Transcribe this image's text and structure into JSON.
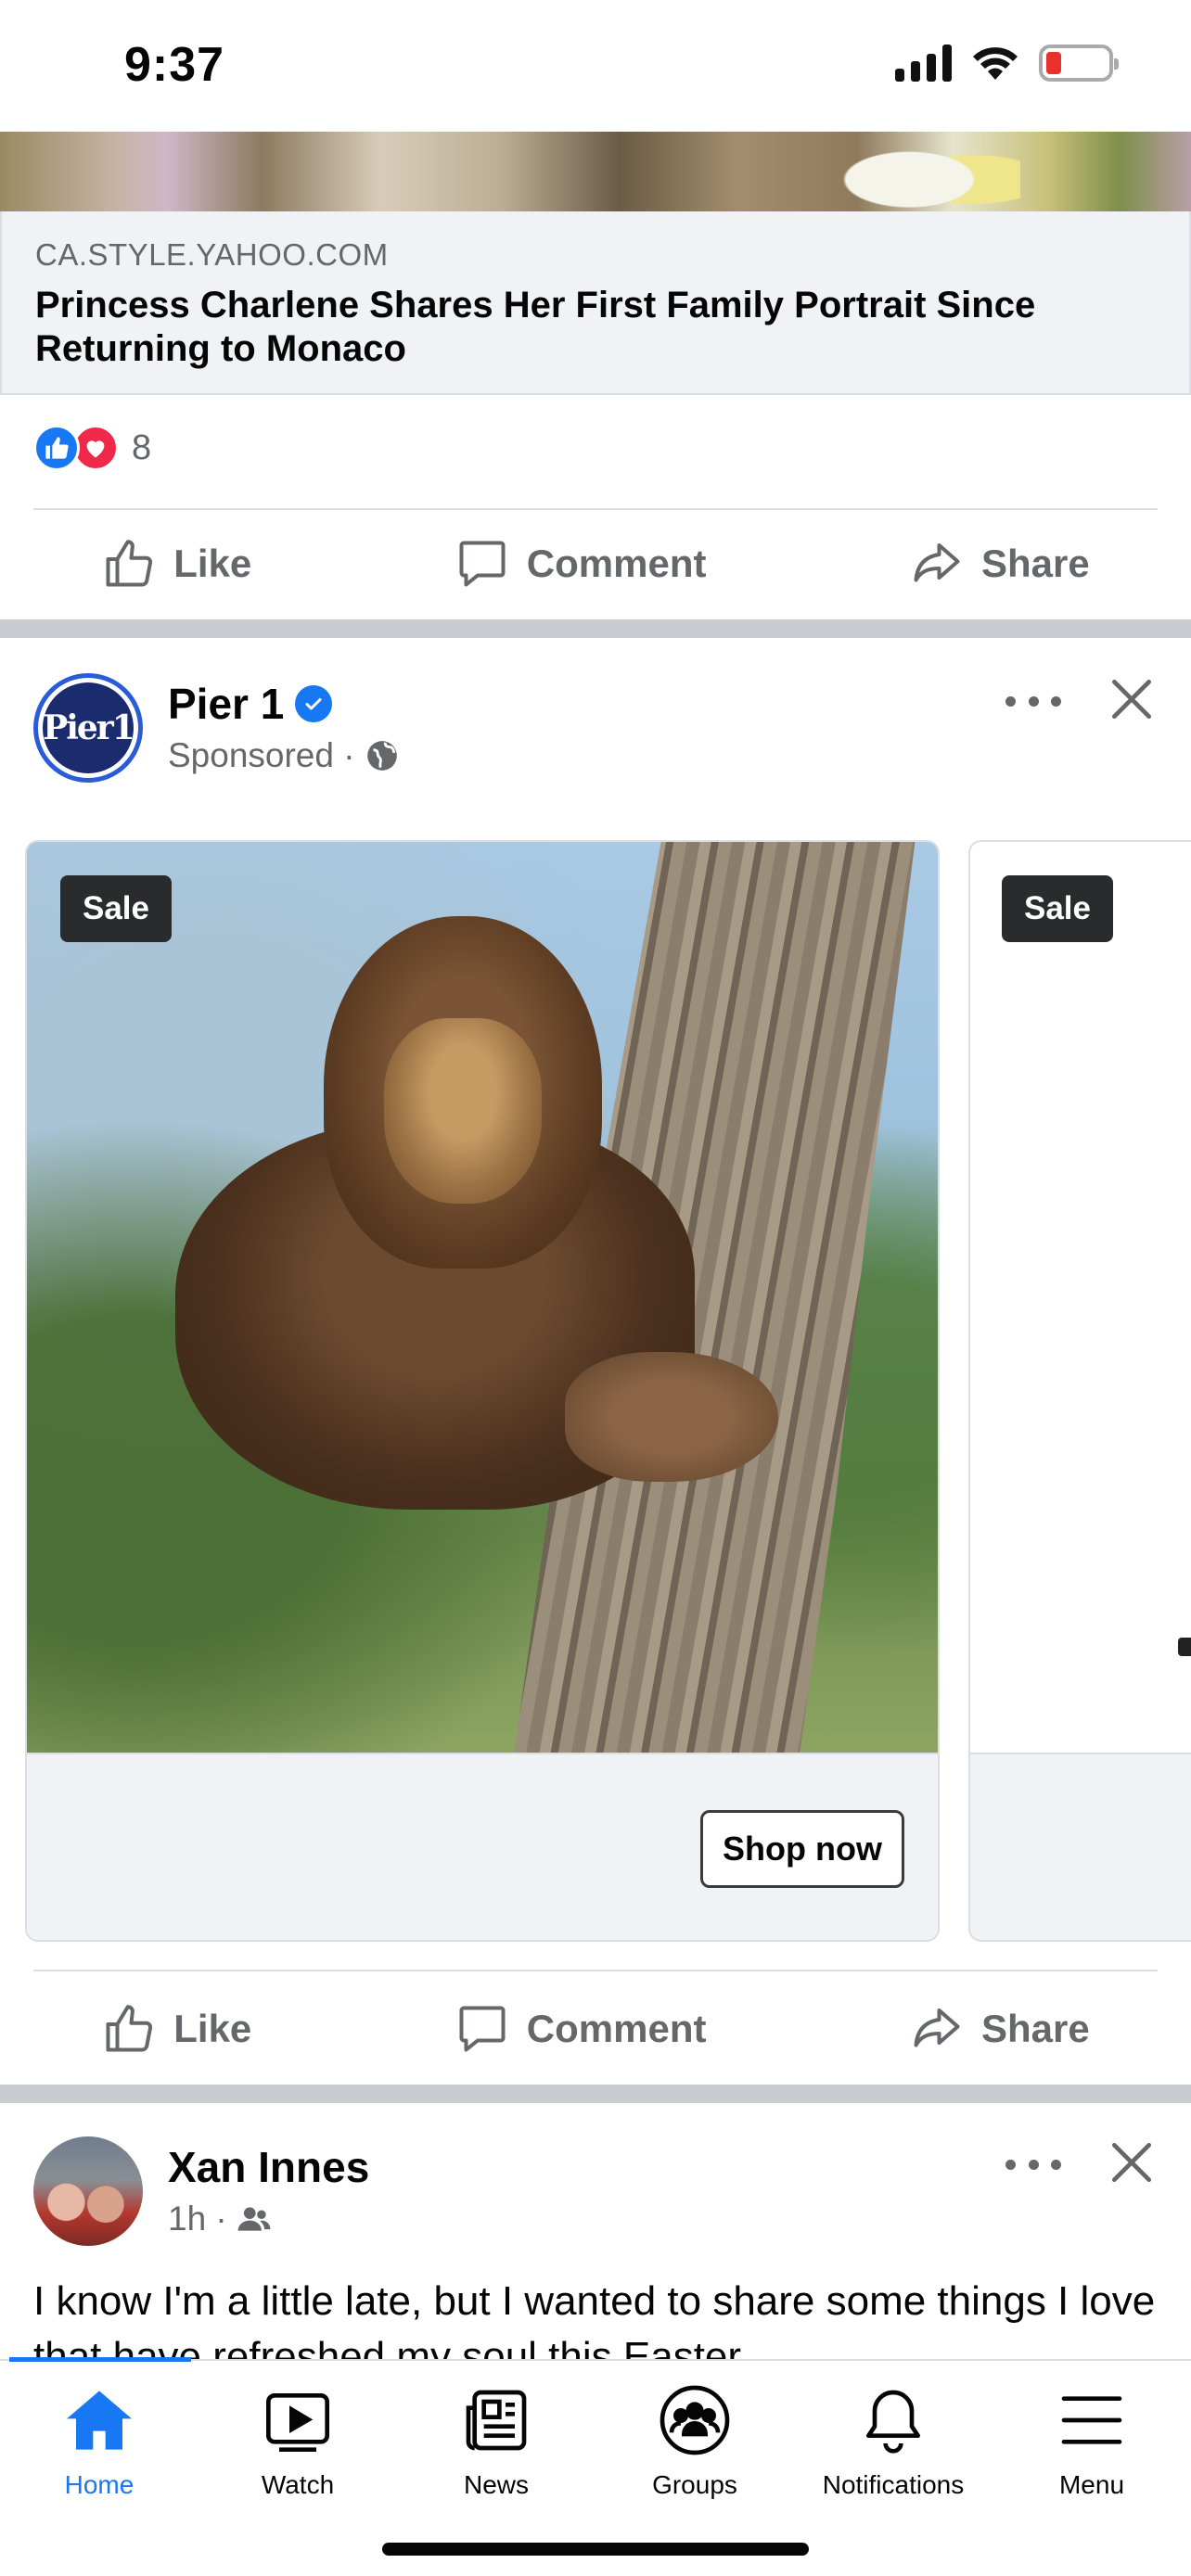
{
  "status_bar": {
    "time": "9:37"
  },
  "link_preview": {
    "domain": "CA.STYLE.YAHOO.COM",
    "title": "Princess Charlene Shares Her First Family Portrait Since Returning to Monaco"
  },
  "first_post": {
    "reaction_count": "8"
  },
  "actions": {
    "like": "Like",
    "comment": "Comment",
    "share": "Share"
  },
  "sponsored_post": {
    "page_name": "Pier 1",
    "avatar_text": "Pier1",
    "meta": "Sponsored ·",
    "cards": [
      {
        "badge": "Sale",
        "cta": "Shop now"
      },
      {
        "badge": "Sale"
      }
    ]
  },
  "friend_post": {
    "author": "Xan Innes",
    "time": "1h ·",
    "text": "I know I'm a little late, but I wanted to share some things I love that have refreshed my soul this Easter"
  },
  "tab_bar": {
    "tabs": [
      {
        "label": "Home",
        "icon": "home-icon",
        "active": true
      },
      {
        "label": "Watch",
        "icon": "watch-icon"
      },
      {
        "label": "News",
        "icon": "news-icon"
      },
      {
        "label": "Groups",
        "icon": "groups-icon"
      },
      {
        "label": "Notifications",
        "icon": "bell-icon"
      },
      {
        "label": "Menu",
        "icon": "menu-icon"
      }
    ]
  },
  "colors": {
    "brand_blue": "#1877f2",
    "secondary_text": "#65676b",
    "divider": "#dadde1",
    "love_red": "#f02849"
  }
}
